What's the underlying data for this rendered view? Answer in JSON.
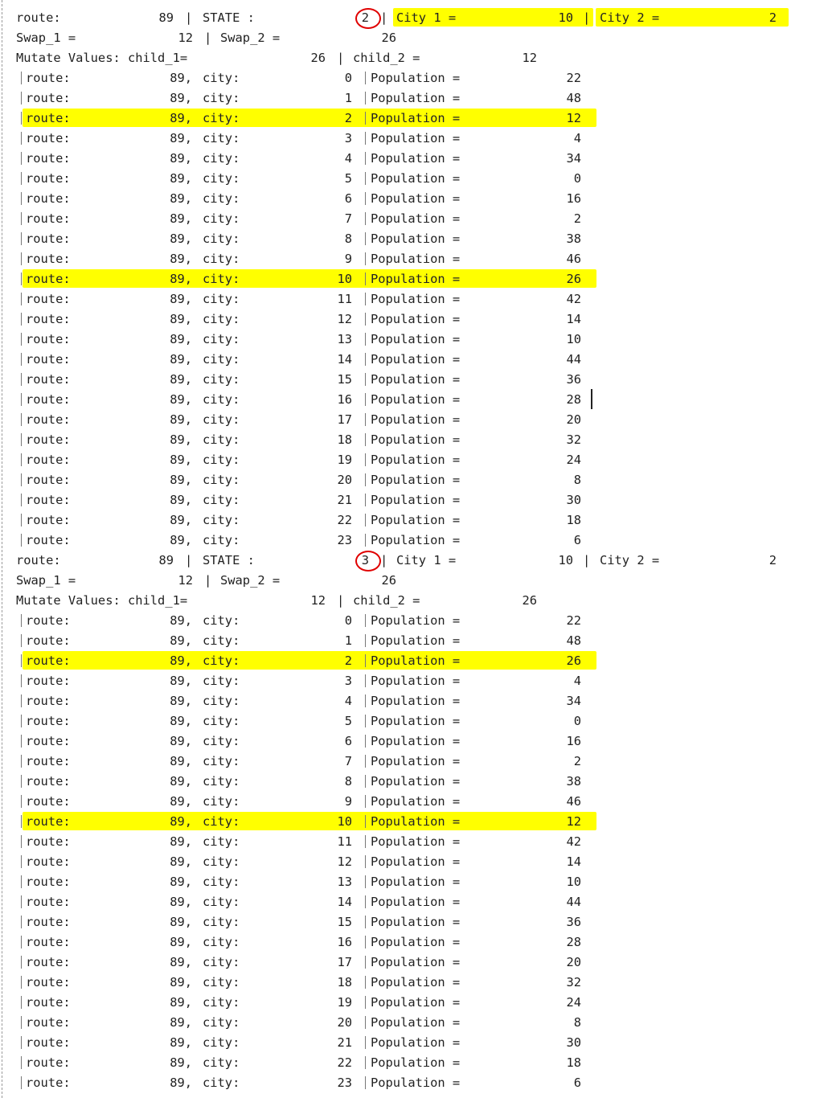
{
  "colors": {
    "highlight": "#ffff00",
    "circle": "#e00000",
    "text": "#222222"
  },
  "blocks": [
    {
      "header": {
        "route_label": "route:",
        "route_value": "89",
        "sep1": "|",
        "state_label": "STATE :",
        "state_value": "2",
        "sep2": "|",
        "city1_label": "City 1 =",
        "city1_value": "10",
        "sep3": "|",
        "city2_label": "City 2 =",
        "city2_value": "2"
      },
      "swap": {
        "swap1_label": "Swap_1 =",
        "swap1_value": "12",
        "sep": "|",
        "swap2_label": "Swap_2 =",
        "swap2_value": "26"
      },
      "mutate": {
        "label": "Mutate Values: child_1=",
        "child1_value": "26",
        "sep": "|",
        "child2_label": "child_2 =",
        "child2_value": "12"
      },
      "rows": [
        {
          "route": "89,",
          "city": "0",
          "pop": "22"
        },
        {
          "route": "89,",
          "city": "1",
          "pop": "48"
        },
        {
          "route": "89,",
          "city": "2",
          "pop": "12"
        },
        {
          "route": "89,",
          "city": "3",
          "pop": "4"
        },
        {
          "route": "89,",
          "city": "4",
          "pop": "34"
        },
        {
          "route": "89,",
          "city": "5",
          "pop": "0"
        },
        {
          "route": "89,",
          "city": "6",
          "pop": "16"
        },
        {
          "route": "89,",
          "city": "7",
          "pop": "2"
        },
        {
          "route": "89,",
          "city": "8",
          "pop": "38"
        },
        {
          "route": "89,",
          "city": "9",
          "pop": "46"
        },
        {
          "route": "89,",
          "city": "10",
          "pop": "26"
        },
        {
          "route": "89,",
          "city": "11",
          "pop": "42"
        },
        {
          "route": "89,",
          "city": "12",
          "pop": "14"
        },
        {
          "route": "89,",
          "city": "13",
          "pop": "10"
        },
        {
          "route": "89,",
          "city": "14",
          "pop": "44"
        },
        {
          "route": "89,",
          "city": "15",
          "pop": "36"
        },
        {
          "route": "89,",
          "city": "16",
          "pop": "28"
        },
        {
          "route": "89,",
          "city": "17",
          "pop": "20"
        },
        {
          "route": "89,",
          "city": "18",
          "pop": "32"
        },
        {
          "route": "89,",
          "city": "19",
          "pop": "24"
        },
        {
          "route": "89,",
          "city": "20",
          "pop": "8"
        },
        {
          "route": "89,",
          "city": "21",
          "pop": "30"
        },
        {
          "route": "89,",
          "city": "22",
          "pop": "18"
        },
        {
          "route": "89,",
          "city": "23",
          "pop": "6"
        }
      ]
    },
    {
      "header": {
        "route_label": "route:",
        "route_value": "89",
        "sep1": "|",
        "state_label": "STATE :",
        "state_value": "3",
        "sep2": "|",
        "city1_label": "City 1 =",
        "city1_value": "10",
        "sep3": "|",
        "city2_label": "City 2 =",
        "city2_value": "2"
      },
      "swap": {
        "swap1_label": "Swap_1 =",
        "swap1_value": "12",
        "sep": "|",
        "swap2_label": "Swap_2 =",
        "swap2_value": "26"
      },
      "mutate": {
        "label": "Mutate Values: child_1=",
        "child1_value": "12",
        "sep": "|",
        "child2_label": "child_2 =",
        "child2_value": "26"
      },
      "rows": [
        {
          "route": "89,",
          "city": "0",
          "pop": "22"
        },
        {
          "route": "89,",
          "city": "1",
          "pop": "48"
        },
        {
          "route": "89,",
          "city": "2",
          "pop": "26"
        },
        {
          "route": "89,",
          "city": "3",
          "pop": "4"
        },
        {
          "route": "89,",
          "city": "4",
          "pop": "34"
        },
        {
          "route": "89,",
          "city": "5",
          "pop": "0"
        },
        {
          "route": "89,",
          "city": "6",
          "pop": "16"
        },
        {
          "route": "89,",
          "city": "7",
          "pop": "2"
        },
        {
          "route": "89,",
          "city": "8",
          "pop": "38"
        },
        {
          "route": "89,",
          "city": "9",
          "pop": "46"
        },
        {
          "route": "89,",
          "city": "10",
          "pop": "12"
        },
        {
          "route": "89,",
          "city": "11",
          "pop": "42"
        },
        {
          "route": "89,",
          "city": "12",
          "pop": "14"
        },
        {
          "route": "89,",
          "city": "13",
          "pop": "10"
        },
        {
          "route": "89,",
          "city": "14",
          "pop": "44"
        },
        {
          "route": "89,",
          "city": "15",
          "pop": "36"
        },
        {
          "route": "89,",
          "city": "16",
          "pop": "28"
        },
        {
          "route": "89,",
          "city": "17",
          "pop": "20"
        },
        {
          "route": "89,",
          "city": "18",
          "pop": "32"
        },
        {
          "route": "89,",
          "city": "19",
          "pop": "24"
        },
        {
          "route": "89,",
          "city": "20",
          "pop": "8"
        },
        {
          "route": "89,",
          "city": "21",
          "pop": "30"
        },
        {
          "route": "89,",
          "city": "22",
          "pop": "18"
        },
        {
          "route": "89,",
          "city": "23",
          "pop": "6"
        }
      ]
    }
  ],
  "row_labels": {
    "route": "route:",
    "city": "city:",
    "population": "Population ="
  },
  "highlights": [
    {
      "block": 0,
      "header_fields": [
        "city1",
        "city2"
      ],
      "rows": [
        2,
        10
      ]
    },
    {
      "block": 1,
      "header_fields": [],
      "rows": [
        2,
        10
      ]
    }
  ],
  "circled": [
    {
      "block": 0,
      "field": "state_value"
    },
    {
      "block": 1,
      "field": "state_value"
    }
  ]
}
